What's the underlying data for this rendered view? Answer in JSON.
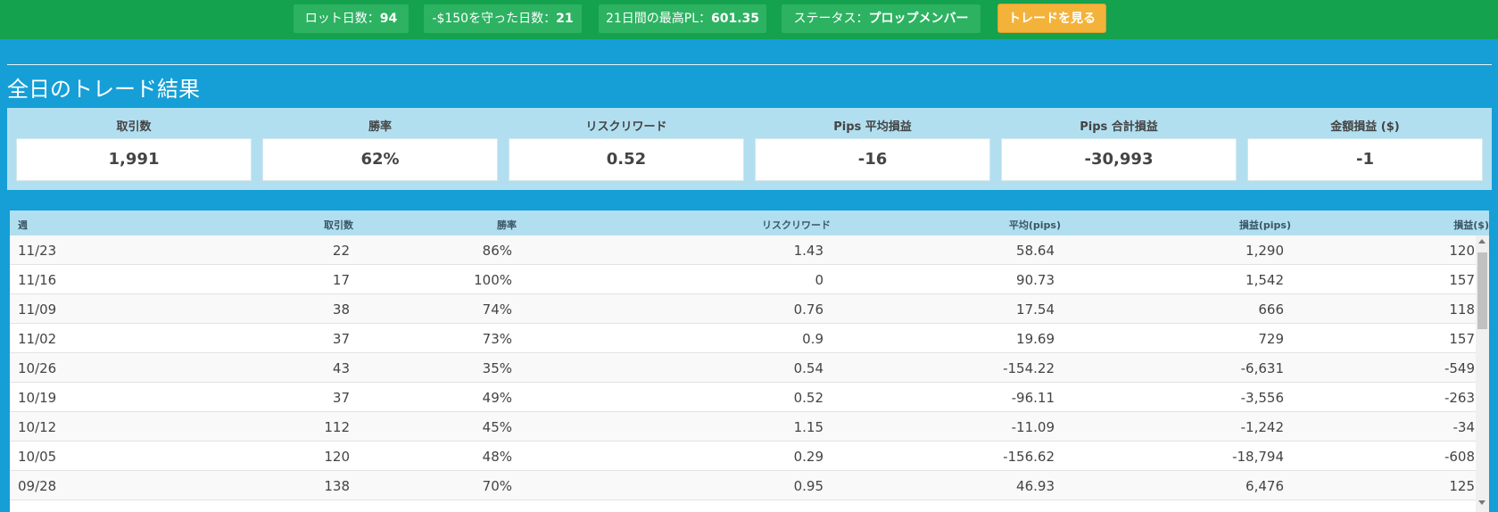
{
  "topbar": {
    "lot_days_label": "ロット日数：",
    "lot_days_value": "94",
    "protect_label": "-$150を守った日数：",
    "protect_value": "21",
    "max_pl_label": "21日間の最高PL：",
    "max_pl_value": "601.35",
    "status_label": "ステータス：",
    "status_value": "プロップメンバー",
    "trade_button": "トレードを見る"
  },
  "page_title": "全日のトレード結果",
  "summary": [
    {
      "label": "取引数",
      "value": "1,991"
    },
    {
      "label": "勝率",
      "value": "62%"
    },
    {
      "label": "リスクリワード",
      "value": "0.52"
    },
    {
      "label": "Pips 平均損益",
      "value": "-16"
    },
    {
      "label": "Pips 合計損益",
      "value": "-30,993"
    },
    {
      "label": "金額損益 ($)",
      "value": "-1"
    }
  ],
  "table": {
    "headers": [
      "週",
      "取引数",
      "勝率",
      "リスクリワード",
      "平均(pips)",
      "損益(pips)",
      "損益($)"
    ],
    "rows": [
      [
        "11/23",
        "22",
        "86%",
        "1.43",
        "58.64",
        "1,290",
        "120"
      ],
      [
        "11/16",
        "17",
        "100%",
        "0",
        "90.73",
        "1,542",
        "157"
      ],
      [
        "11/09",
        "38",
        "74%",
        "0.76",
        "17.54",
        "666",
        "118"
      ],
      [
        "11/02",
        "37",
        "73%",
        "0.9",
        "19.69",
        "729",
        "157"
      ],
      [
        "10/26",
        "43",
        "35%",
        "0.54",
        "-154.22",
        "-6,631",
        "-549"
      ],
      [
        "10/19",
        "37",
        "49%",
        "0.52",
        "-96.11",
        "-3,556",
        "-263"
      ],
      [
        "10/12",
        "112",
        "45%",
        "1.15",
        "-11.09",
        "-1,242",
        "-34"
      ],
      [
        "10/05",
        "120",
        "48%",
        "0.29",
        "-156.62",
        "-18,794",
        "-608"
      ],
      [
        "09/28",
        "138",
        "70%",
        "0.95",
        "46.93",
        "6,476",
        "125"
      ]
    ]
  },
  "colors": {
    "topbar": "#15a24f",
    "page_bg": "#159fd6",
    "accent_button": "#f3b33a",
    "summary_bg": "#b2dff0"
  }
}
